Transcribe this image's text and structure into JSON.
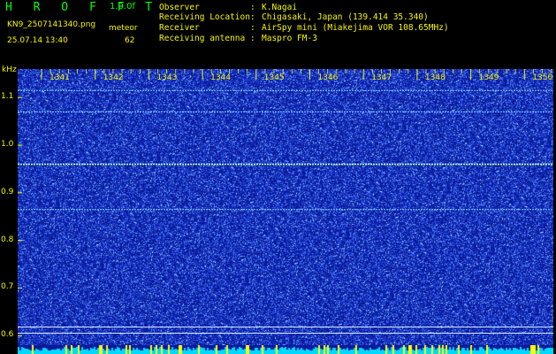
{
  "header": {
    "app_title": "H R O F F T",
    "version": "1.0.0f",
    "filename": "KN9_2507141340.png",
    "datetime": "25.07.14 13:40",
    "meteor_label": "meteor",
    "meteor_count": "62",
    "info": [
      {
        "label": "Observer",
        "value": "K.Nagai"
      },
      {
        "label": "Receiving Location",
        "value": "Chigasaki, Japan (139.414 35.340)"
      },
      {
        "label": "Receiver",
        "value": "AirSpy mini (Miakejima VOR 108.65MHz)"
      },
      {
        "label": "Receiving antenna",
        "value": "Maspro FM-3"
      }
    ]
  },
  "chart_data": {
    "type": "heatmap",
    "y_unit": "kHz",
    "x_ticks": [
      "1341",
      "1342",
      "1343",
      "1344",
      "1345",
      "1346",
      "1347",
      "1348",
      "1349",
      "1350"
    ],
    "y_ticks": [
      "1.1",
      "1.0",
      "0.9",
      "0.8",
      "0.7",
      "0.6"
    ],
    "ylim": [
      0.58,
      1.16
    ],
    "carrier_lines_khz": [
      1.115,
      1.07,
      0.96,
      0.865,
      0.618,
      0.605
    ],
    "colors": {
      "background": "#0a1a9c",
      "noise": "#3f6cff",
      "bright": "#a8ffd0",
      "label": "#f5f500"
    }
  }
}
